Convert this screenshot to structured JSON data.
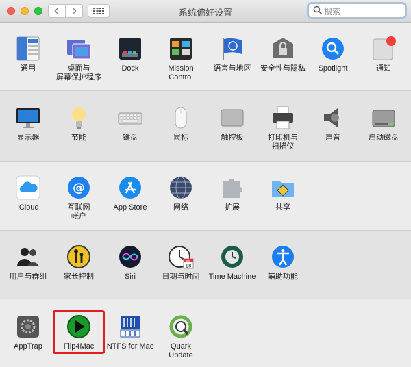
{
  "window": {
    "title": "系统偏好设置"
  },
  "search": {
    "placeholder": "搜索"
  },
  "sections": [
    {
      "items": [
        {
          "label": "通用",
          "icon": "general-icon"
        },
        {
          "label": "桌面与\n屏幕保护程序",
          "icon": "desktop-screensaver-icon"
        },
        {
          "label": "Dock",
          "icon": "dock-icon"
        },
        {
          "label": "Mission\nControl",
          "icon": "mission-control-icon"
        },
        {
          "label": "语言与地区",
          "icon": "language-region-icon"
        },
        {
          "label": "安全性与隐私",
          "icon": "security-privacy-icon"
        },
        {
          "label": "Spotlight",
          "icon": "spotlight-icon"
        },
        {
          "label": "通知",
          "icon": "notifications-icon"
        }
      ]
    },
    {
      "items": [
        {
          "label": "显示器",
          "icon": "displays-icon"
        },
        {
          "label": "节能",
          "icon": "energy-saver-icon"
        },
        {
          "label": "键盘",
          "icon": "keyboard-icon"
        },
        {
          "label": "鼠标",
          "icon": "mouse-icon"
        },
        {
          "label": "触控板",
          "icon": "trackpad-icon"
        },
        {
          "label": "打印机与\n扫描仪",
          "icon": "printers-scanners-icon"
        },
        {
          "label": "声音",
          "icon": "sound-icon"
        },
        {
          "label": "启动磁盘",
          "icon": "startup-disk-icon"
        }
      ]
    },
    {
      "items": [
        {
          "label": "iCloud",
          "icon": "icloud-icon"
        },
        {
          "label": "互联网\n帐户",
          "icon": "internet-accounts-icon"
        },
        {
          "label": "App Store",
          "icon": "app-store-icon"
        },
        {
          "label": "网络",
          "icon": "network-icon"
        },
        {
          "label": "扩展",
          "icon": "extensions-icon"
        },
        {
          "label": "共享",
          "icon": "sharing-icon"
        }
      ]
    },
    {
      "items": [
        {
          "label": "用户与群组",
          "icon": "users-groups-icon"
        },
        {
          "label": "家长控制",
          "icon": "parental-controls-icon"
        },
        {
          "label": "Siri",
          "icon": "siri-icon"
        },
        {
          "label": "日期与时间",
          "icon": "date-time-icon"
        },
        {
          "label": "Time Machine",
          "icon": "time-machine-icon"
        },
        {
          "label": "辅助功能",
          "icon": "accessibility-icon"
        }
      ]
    },
    {
      "items": [
        {
          "label": "AppTrap",
          "icon": "apptrap-icon"
        },
        {
          "label": "Flip4Mac",
          "icon": "flip4mac-icon"
        },
        {
          "label": "NTFS for Mac",
          "icon": "ntfs-for-mac-icon"
        },
        {
          "label": "Quark\nUpdate",
          "icon": "quark-update-icon"
        }
      ]
    }
  ],
  "icon_text": {
    "calendar_month": "JUL",
    "calendar_day": "18"
  },
  "colors": {
    "highlight": "#e0201f",
    "notification_badge": "#fc3d39",
    "accent_blue": "#1a7df0"
  }
}
